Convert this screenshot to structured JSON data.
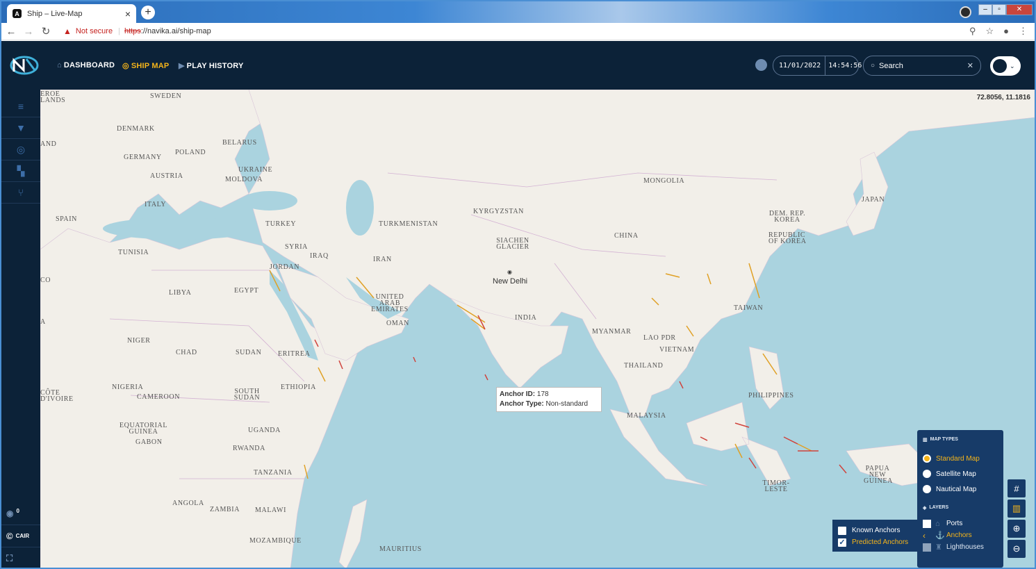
{
  "browser": {
    "tab_title": "Ship – Live-Map",
    "url_warning": "Not secure",
    "url_scheme": "https",
    "url_rest": "://navika.ai/ship-map"
  },
  "header": {
    "nav": [
      {
        "label": "DASHBOARD",
        "icon": "home-icon"
      },
      {
        "label": "SHIP MAP",
        "icon": "target-icon",
        "active": true
      },
      {
        "label": "PLAY HISTORY",
        "icon": "play-icon"
      }
    ],
    "date": "11/01/2022",
    "time": "14:54:56",
    "search_placeholder": "Search"
  },
  "sidebar": {
    "items": [
      "menu-icon",
      "filter-icon",
      "globe-icon",
      "puzzle-icon",
      "network-icon"
    ],
    "counter": "0",
    "brand": "CAIR"
  },
  "map": {
    "coordinate_readout": "72.8056, 11.1816",
    "labels": [
      "EROE LANDS",
      "SWEDEN",
      "DENMARK",
      "AND",
      "BELARUS",
      "POLAND",
      "GERMANY",
      "UKRAINE",
      "AUSTRIA",
      "MOLDOVA",
      "ITALY",
      "SPAIN",
      "TURKEY",
      "TURKMENISTAN",
      "KYRGYZSTAN",
      "MONGOLIA",
      "DEM. REP. KOREA",
      "JAPAN",
      "REPUBLIC OF KOREA",
      "CHINA",
      "SIACHEN GLACIER",
      "SYRIA",
      "IRAQ",
      "IRAN",
      "TUNISIA",
      "JORDAN",
      "CO",
      "LIBYA",
      "EGYPT",
      "UNITED ARAB EMIRATES",
      "OMAN",
      "INDIA",
      "TAIWAN",
      "MYANMAR",
      "LAO PDR",
      "VIETNAM",
      "THAILAND",
      "A",
      "NIGER",
      "CHAD",
      "SUDAN",
      "ERITREA",
      "NIGERIA",
      "ETHIOPIA",
      "SOUTH SUDAN",
      "PHILIPPINES",
      "CÔTE D'IVOIRE",
      "CAMEROON",
      "MALAYSIA",
      "EQUATORIAL GUINEA",
      "GABON",
      "UGANDA",
      "RWANDA",
      "TANZANIA",
      "PAPUA NEW GUINEA",
      "TIMOR-LESTE",
      "ANGOLA",
      "ZAMBIA",
      "MALAWI",
      "MOZAMBIQUE",
      "MAURITIUS"
    ],
    "city": "New Delhi",
    "tooltip": {
      "id_label": "Anchor ID:",
      "id_value": "178",
      "type_label": "Anchor Type:",
      "type_value": "Non-standard"
    },
    "anchor_filters": [
      {
        "label": "Known Anchors",
        "checked": false
      },
      {
        "label": "Predicted Anchors",
        "checked": true
      }
    ],
    "map_types_title": "MAP TYPES",
    "map_types": [
      {
        "label": "Standard Map",
        "selected": true
      },
      {
        "label": "Satellite Map",
        "selected": false
      },
      {
        "label": "Nautical Map",
        "selected": false
      }
    ],
    "layers_title": "LAYERS",
    "layers": [
      {
        "label": "Ports",
        "state": "off"
      },
      {
        "label": "Anchors",
        "state": "on"
      },
      {
        "label": "Lighthouses",
        "state": "disabled"
      }
    ]
  }
}
